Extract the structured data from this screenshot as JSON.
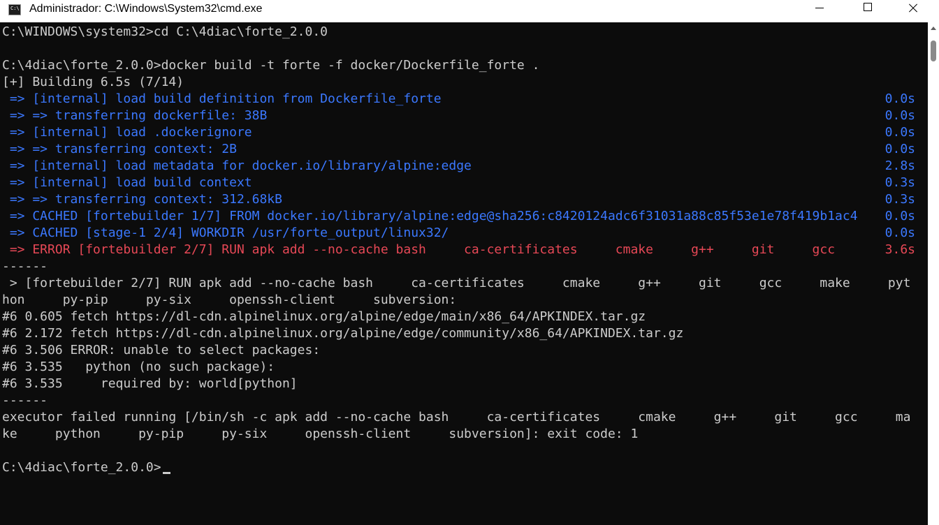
{
  "window": {
    "title": "Administrador: C:\\Windows\\System32\\cmd.exe",
    "icon": "cmd-console-icon",
    "icon_glyph": "C:\\"
  },
  "terminal": {
    "colors": {
      "background": "#0c0c0c",
      "text": "#cccccc",
      "blue": "#3b78ff",
      "red": "#e74856"
    },
    "lines_before": [
      "C:\\WINDOWS\\system32>cd C:\\4diac\\forte_2.0.0",
      "",
      "C:\\4diac\\forte_2.0.0>docker build -t forte -f docker/Dockerfile_forte .",
      "[+] Building 6.5s (7/14)"
    ],
    "build_steps": [
      {
        "text": " => [internal] load build definition from Dockerfile_forte",
        "time": "0.0s",
        "color": "blue"
      },
      {
        "text": " => => transferring dockerfile: 38B",
        "time": "0.0s",
        "color": "blue"
      },
      {
        "text": " => [internal] load .dockerignore",
        "time": "0.0s",
        "color": "blue"
      },
      {
        "text": " => => transferring context: 2B",
        "time": "0.0s",
        "color": "blue"
      },
      {
        "text": " => [internal] load metadata for docker.io/library/alpine:edge",
        "time": "2.8s",
        "color": "blue"
      },
      {
        "text": " => [internal] load build context",
        "time": "0.3s",
        "color": "blue"
      },
      {
        "text": " => => transferring context: 312.68kB",
        "time": "0.3s",
        "color": "blue"
      },
      {
        "text": " => CACHED [fortebuilder 1/7] FROM docker.io/library/alpine:edge@sha256:c8420124adc6f31031a88c85f53e1e78f419b1ac4",
        "time": "0.0s",
        "color": "blue"
      },
      {
        "text": " => CACHED [stage-1 2/4] WORKDIR /usr/forte_output/linux32/",
        "time": "0.0s",
        "color": "blue"
      },
      {
        "text": " => ERROR [fortebuilder 2/7] RUN apk add --no-cache bash     ca-certificates     cmake     g++     git     gcc",
        "time": "3.6s",
        "color": "red"
      }
    ],
    "lines_after": [
      "------",
      " > [fortebuilder 2/7] RUN apk add --no-cache bash     ca-certificates     cmake     g++     git     gcc     make     pyt",
      "hon     py-pip     py-six     openssh-client     subversion:",
      "#6 0.605 fetch https://dl-cdn.alpinelinux.org/alpine/edge/main/x86_64/APKINDEX.tar.gz",
      "#6 2.172 fetch https://dl-cdn.alpinelinux.org/alpine/edge/community/x86_64/APKINDEX.tar.gz",
      "#6 3.506 ERROR: unable to select packages:",
      "#6 3.535   python (no such package):",
      "#6 3.535     required by: world[python]",
      "------",
      "executor failed running [/bin/sh -c apk add --no-cache bash     ca-certificates     cmake     g++     git     gcc     ma",
      "ke     python     py-pip     py-six     openssh-client     subversion]: exit code: 1",
      ""
    ],
    "prompt": "C:\\4diac\\forte_2.0.0>"
  }
}
